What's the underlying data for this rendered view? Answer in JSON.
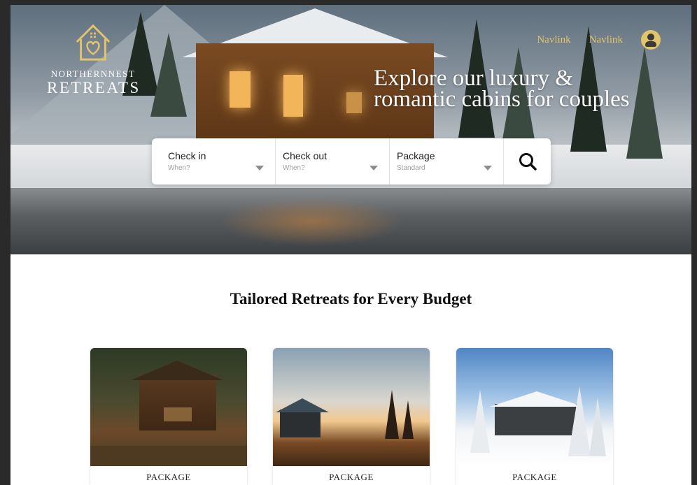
{
  "brand": {
    "name_top": "NORTHERNNEST",
    "name_main": "RETREATS"
  },
  "nav": {
    "links": [
      "Navlink",
      "Navlink"
    ],
    "accent_color": "#e2c46a"
  },
  "hero": {
    "heading_line1": "Explore our luxury &",
    "heading_line2": "romantic cabins for couples"
  },
  "search": {
    "fields": [
      {
        "label": "Check in",
        "value": "When?"
      },
      {
        "label": "Check out",
        "value": "When?"
      },
      {
        "label": "Package",
        "value": "Standard"
      }
    ],
    "button_icon": "search-icon"
  },
  "section": {
    "title": "Tailored Retreats for Every Budget"
  },
  "cards": [
    {
      "label": "PACKAGE"
    },
    {
      "label": "PACKAGE"
    },
    {
      "label": "PACKAGE"
    }
  ]
}
